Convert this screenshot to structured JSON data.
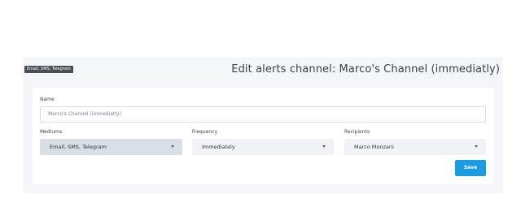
{
  "tooltip": "Email, SMS, Telegram",
  "page_title": "Edit alerts channel: Marco's Channel (immediatly)",
  "form": {
    "name_label": "Name",
    "name_value": "Marco's Channel (immediatly)",
    "mediums_label": "Mediums",
    "mediums_value": "Email, SMS, Telegram",
    "frequency_label": "Frequency",
    "frequency_value": "Immediately",
    "recipients_label": "Recipients",
    "recipients_value": "Marco Monzani",
    "save_label": "Save"
  },
  "colors": {
    "accent": "#1a9be2",
    "panel_bg": "#f4f6fa",
    "tooltip_bg": "#4a4f55"
  },
  "icons": {
    "select_chevron": "chevron-down-icon"
  }
}
